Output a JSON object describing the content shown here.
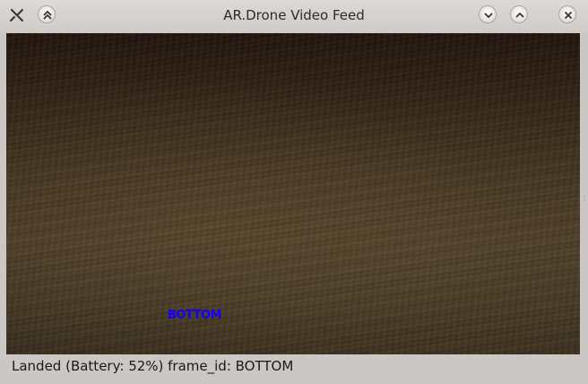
{
  "window": {
    "title": "AR.Drone Video Feed"
  },
  "titlebar_buttons": {
    "left": [
      "app-menu-icon",
      "keep-above-icon"
    ],
    "right": [
      "minimize-icon",
      "maximize-icon",
      "close-icon"
    ]
  },
  "video": {
    "overlay_label": "BOTTOM",
    "overlay_color": "#1400ff"
  },
  "status": {
    "text": "Landed (Battery: 52%) frame_id: BOTTOM"
  }
}
